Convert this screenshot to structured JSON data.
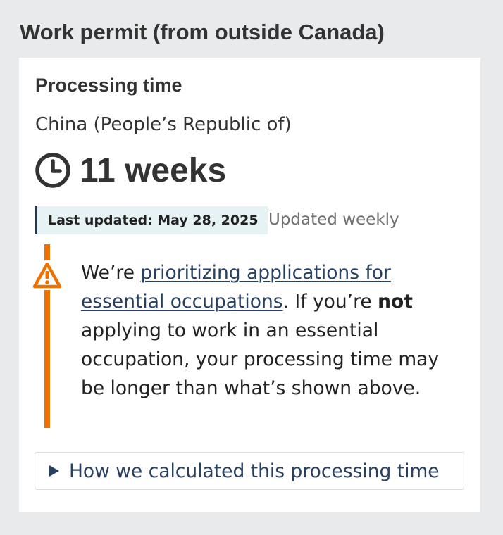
{
  "page": {
    "title": "Work permit (from outside Canada)"
  },
  "processing": {
    "heading": "Processing time",
    "country": "China (People’s Republic of)",
    "time_value": "11 weeks",
    "time_icon": "clock-icon",
    "last_updated": "Last updated: May 28, 2025",
    "update_frequency": "Updated weekly"
  },
  "notice": {
    "icon": "warning-icon",
    "accent_color": "#ee7100",
    "prefix": "We’re ",
    "link_text": "prioritizing applications for essential occupations",
    "after_link": ". If you’re ",
    "bold_word": "not",
    "suffix": " applying to work in an essential occupation, your processing time may be longer than what’s shown above."
  },
  "details": {
    "summary_label": "How we calculated this processing time",
    "expand_icon": "triangle-right-icon"
  },
  "colors": {
    "link": "#284162",
    "page_background": "#e9eaec",
    "badge_background": "#e7f2f5",
    "badge_border": "#26374a"
  }
}
